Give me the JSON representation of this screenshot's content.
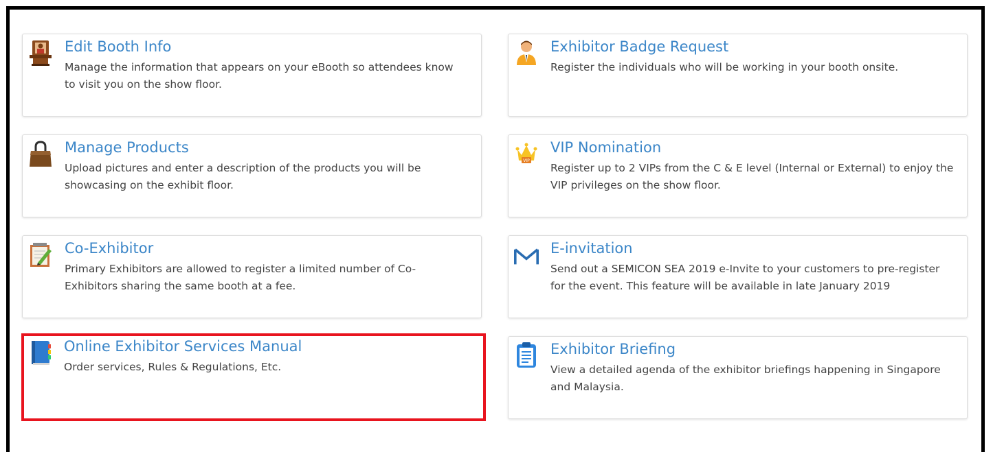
{
  "cards": [
    {
      "title": "Edit Booth Info",
      "desc_line1": "Manage the information that appears on your eBooth so attendees know",
      "desc_line2": "to visit you on the show floor.",
      "icon": "booth-icon"
    },
    {
      "title": "Exhibitor Badge Request",
      "desc_line1": "Register the individuals who will be working in your booth onsite.",
      "desc_line2": "",
      "icon": "person-badge-icon"
    },
    {
      "title": "Manage Products",
      "desc_line1": "Upload pictures and enter a description of the products you will be",
      "desc_line2": "showcasing on the exhibit floor.",
      "icon": "shopping-bag-icon"
    },
    {
      "title": "VIP Nomination",
      "desc_line1": "Register up to 2 VIPs from the C & E level (Internal or External) to enjoy the",
      "desc_line2": "VIP privileges on the show floor.",
      "icon": "vip-crown-icon"
    },
    {
      "title": "Co-Exhibitor",
      "desc_line1": "Primary Exhibitors are allowed to register a limited number of Co-",
      "desc_line2": "Exhibitors sharing the same booth at a fee.",
      "icon": "notepad-pencil-icon"
    },
    {
      "title": "E-invitation",
      "desc_line1": "Send out a SEMICON SEA 2019 e-Invite to your customers to pre-register",
      "desc_line2": "for the event. This feature will be available in late January 2019",
      "icon": "mail-icon"
    },
    {
      "title": "Online Exhibitor Services Manual",
      "desc_line1": "Order services, Rules & Regulations, Etc.",
      "desc_line2": "",
      "icon": "manual-book-icon"
    },
    {
      "title": "Exhibitor Briefing",
      "desc_line1": "View a detailed agenda of the exhibitor briefings happening in Singapore",
      "desc_line2": "and Malaysia.",
      "icon": "clipboard-icon"
    }
  ],
  "colors": {
    "title_link": "#3b86c8",
    "highlight_border": "#e8141e",
    "frame_border": "#000000"
  }
}
